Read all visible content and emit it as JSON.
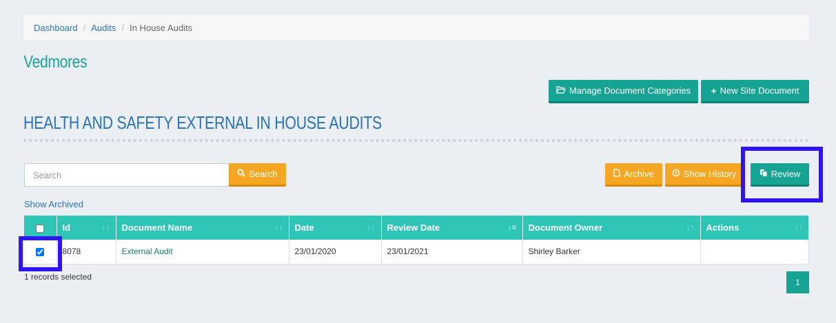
{
  "breadcrumb": {
    "items": [
      "Dashboard",
      "Audits"
    ],
    "current": "In House Audits"
  },
  "site_title": "Vedmores",
  "header_buttons": {
    "manage": "Manage Document Categories",
    "new_doc": "New Site Document"
  },
  "section_title": "HEALTH AND SAFETY EXTERNAL IN HOUSE AUDITS",
  "search": {
    "placeholder": "Search",
    "button": "Search"
  },
  "toolbar": {
    "archive": "Archive",
    "history": "Show History",
    "review": "Review"
  },
  "show_archived": "Show Archived",
  "table": {
    "columns": [
      "Id",
      "Document Name",
      "Date",
      "Review Date",
      "Document Owner",
      "Actions"
    ],
    "rows": [
      {
        "id": "8078",
        "name": "External Audit",
        "date": "23/01/2020",
        "review_date": "23/01/2021",
        "owner": "Shirley Barker",
        "actions": "",
        "checked": true
      }
    ]
  },
  "records_selected": "1 records selected",
  "pagination": {
    "current": "1"
  },
  "colors": {
    "teal": "#16a394",
    "header": "#2ec4b6",
    "orange": "#f5a623",
    "highlight": "#2d14f0",
    "link": "#2a73b8"
  }
}
